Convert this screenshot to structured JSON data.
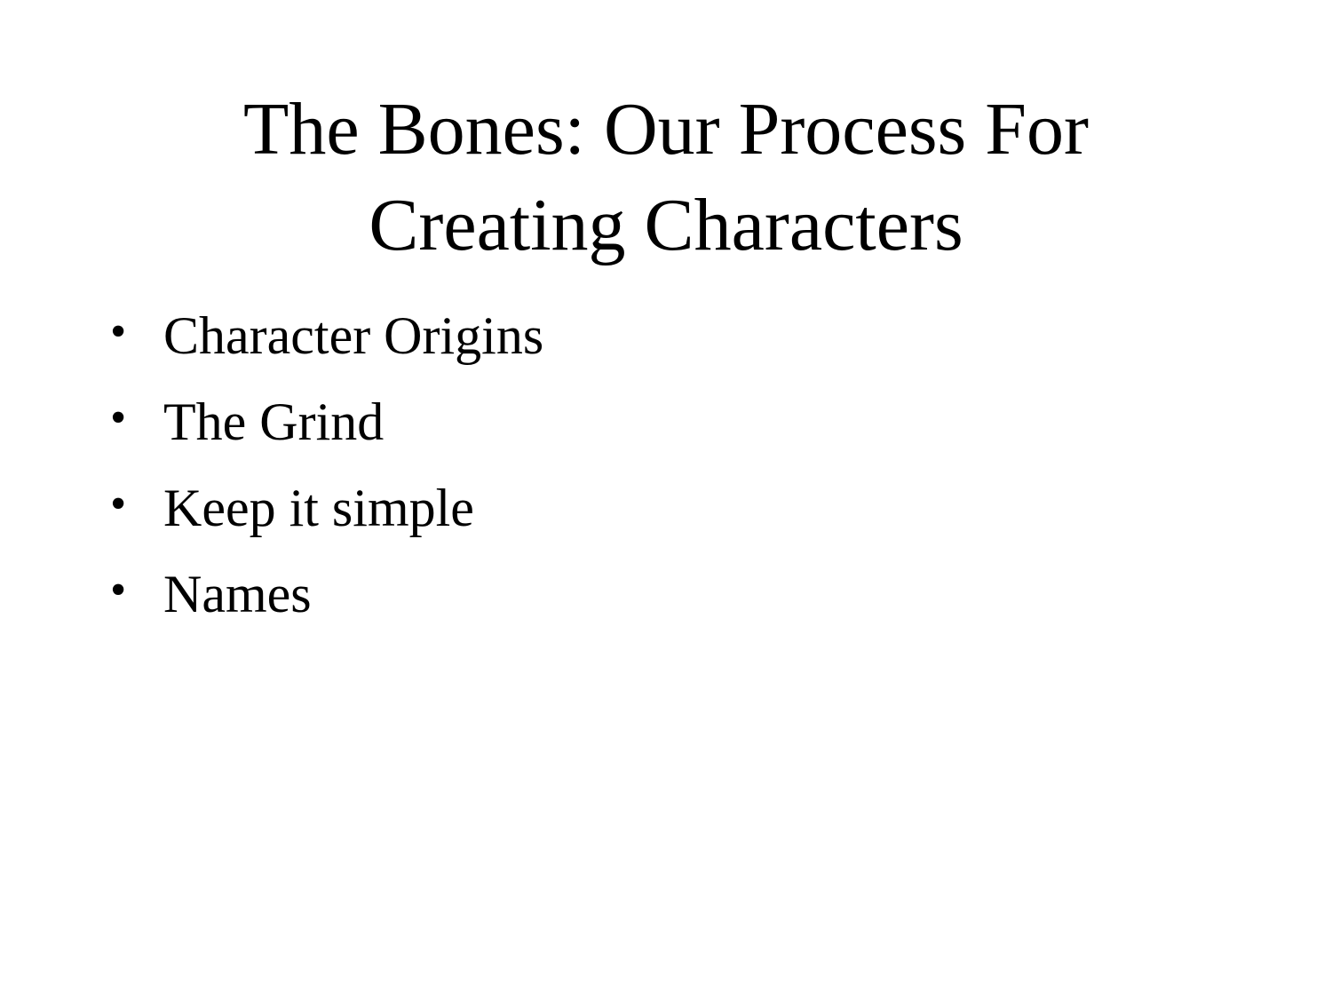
{
  "slide": {
    "title_lines": [
      "The Bones: Our Process For",
      "Creating Characters"
    ],
    "bullet_symbol": "•",
    "bullets": [
      "Character Origins",
      "The Grind",
      "Keep it simple",
      "Names"
    ]
  }
}
